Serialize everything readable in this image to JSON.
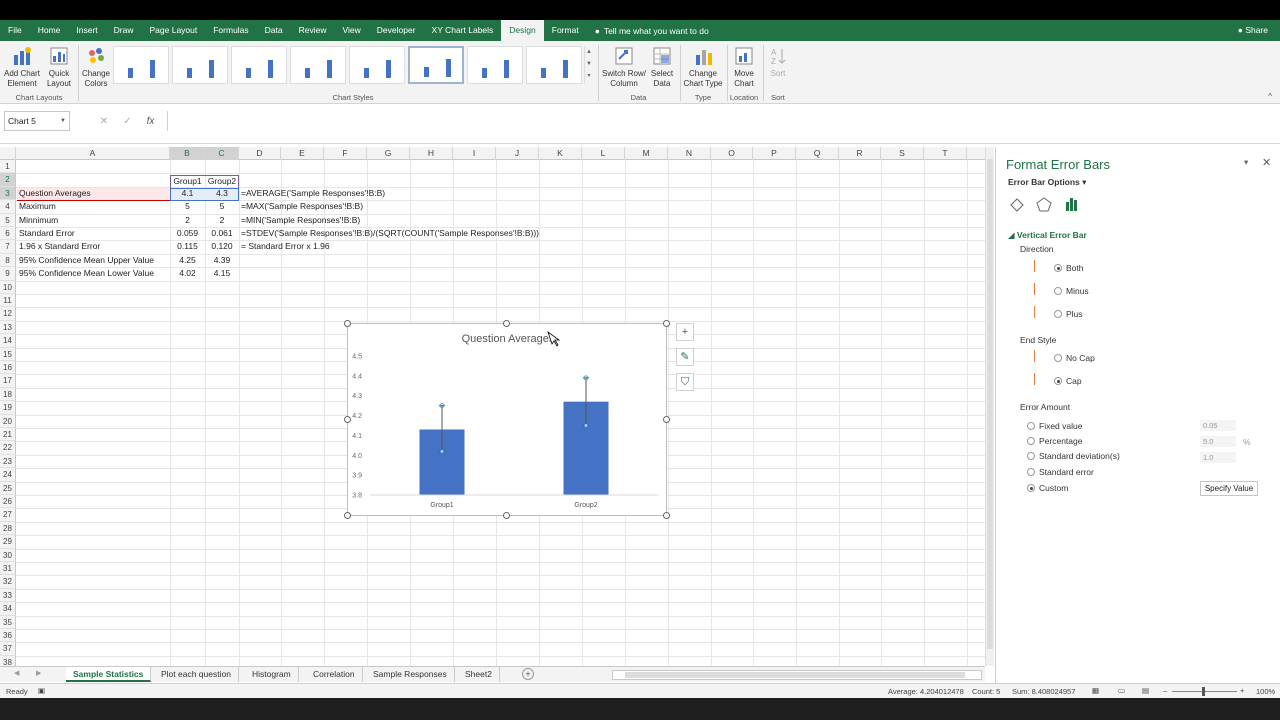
{
  "ribbon_tabs": [
    "File",
    "Home",
    "Insert",
    "Draw",
    "Page Layout",
    "Formulas",
    "Data",
    "Review",
    "View",
    "Developer",
    "XY Chart Labels",
    "Design",
    "Format"
  ],
  "active_tab": "Design",
  "tell_me": "Tell me what you want to do",
  "share": "Share",
  "ribbon": {
    "add_chart_element": "Add Chart\nElement",
    "quick_layout": "Quick\nLayout",
    "change_colors": "Change\nColors",
    "switch_row_col": "Switch Row/\nColumn",
    "select_data": "Select\nData",
    "change_chart_type": "Change\nChart Type",
    "move_chart": "Move\nChart",
    "sort": "Sort",
    "groups": {
      "chart_layouts": "Chart Layouts",
      "chart_styles": "Chart Styles",
      "data": "Data",
      "type": "Type",
      "location": "Location",
      "sort": "Sort"
    }
  },
  "namebox": "Chart 5",
  "fx": "fx",
  "columns": [
    "A",
    "B",
    "C",
    "D",
    "E",
    "F",
    "G",
    "H",
    "I",
    "J",
    "K",
    "L",
    "M",
    "N",
    "O",
    "P",
    "Q",
    "R",
    "S",
    "T"
  ],
  "rows": [
    "1",
    "2",
    "3",
    "4",
    "5",
    "6",
    "7",
    "8",
    "9",
    "10",
    "11",
    "12",
    "13",
    "14",
    "15",
    "16",
    "17",
    "18",
    "19",
    "20",
    "21",
    "22",
    "23",
    "24",
    "25",
    "26",
    "27",
    "28",
    "29",
    "30",
    "31",
    "32",
    "33",
    "34",
    "35",
    "36",
    "37",
    "38"
  ],
  "cells": {
    "group1": "Group1",
    "group2": "Group2",
    "table": [
      {
        "label": "Question Averages",
        "b": "4.1",
        "c": "4.3",
        "note": "=AVERAGE('Sample Responses'!B:B)"
      },
      {
        "label": "Maximum",
        "b": "5",
        "c": "5",
        "note": "=MAX('Sample Responses'!B:B)"
      },
      {
        "label": "Minnimum",
        "b": "2",
        "c": "2",
        "note": "=MIN('Sample Responses'!B:B)"
      },
      {
        "label": "Standard Error",
        "b": "0.059",
        "c": "0.061",
        "note": "=STDEV('Sample Responses'!B:B)/(SQRT(COUNT('Sample Responses'!B:B)))"
      },
      {
        "label": "1.96 x Standard Error",
        "b": "0.115",
        "c": "0.120",
        "note": "= Standard Error x 1.96"
      },
      {
        "label": "95% Confidence Mean Upper Value",
        "b": "4.25",
        "c": "4.39",
        "note": ""
      },
      {
        "label": "95% Confidence Mean Lower Value",
        "b": "4.02",
        "c": "4.15",
        "note": ""
      }
    ]
  },
  "chart_data": {
    "type": "bar",
    "title": "Question Averages",
    "categories": [
      "Group1",
      "Group2"
    ],
    "values": [
      4.13,
      4.27
    ],
    "error_high": [
      4.25,
      4.39
    ],
    "error_low": [
      4.02,
      4.15
    ],
    "ylim": [
      3.8,
      4.5
    ],
    "yticks": [
      "3.8",
      "3.9",
      "4.0",
      "4.1",
      "4.2",
      "4.3",
      "4.4",
      "4.5"
    ],
    "bar_color": "#4472c4"
  },
  "sheet_tabs": [
    "Sample Statistics",
    "Plot each question",
    "Histogram",
    "Correlation",
    "Sample Responses",
    "Sheet2"
  ],
  "active_sheet": "Sample Statistics",
  "status": {
    "ready": "Ready",
    "average": "Average: 4.204012478",
    "count": "Count: 5",
    "sum": "Sum: 8.408024957",
    "zoom": "100%"
  },
  "pane": {
    "title": "Format Error Bars",
    "options_label": "Error Bar Options",
    "section": "Vertical Error Bar",
    "direction_label": "Direction",
    "directions": [
      "Both",
      "Minus",
      "Plus"
    ],
    "direction_selected": "Both",
    "end_style_label": "End Style",
    "end_styles": [
      "No Cap",
      "Cap"
    ],
    "end_style_selected": "Cap",
    "amount_label": "Error Amount",
    "amounts": [
      "Fixed value",
      "Percentage",
      "Standard deviation(s)",
      "Standard error",
      "Custom"
    ],
    "amount_selected": "Custom",
    "fixed_value": "0.05",
    "percentage": "5.0",
    "percent_sign": "%",
    "std_dev": "1.0",
    "specify_value": "Specify Value"
  }
}
